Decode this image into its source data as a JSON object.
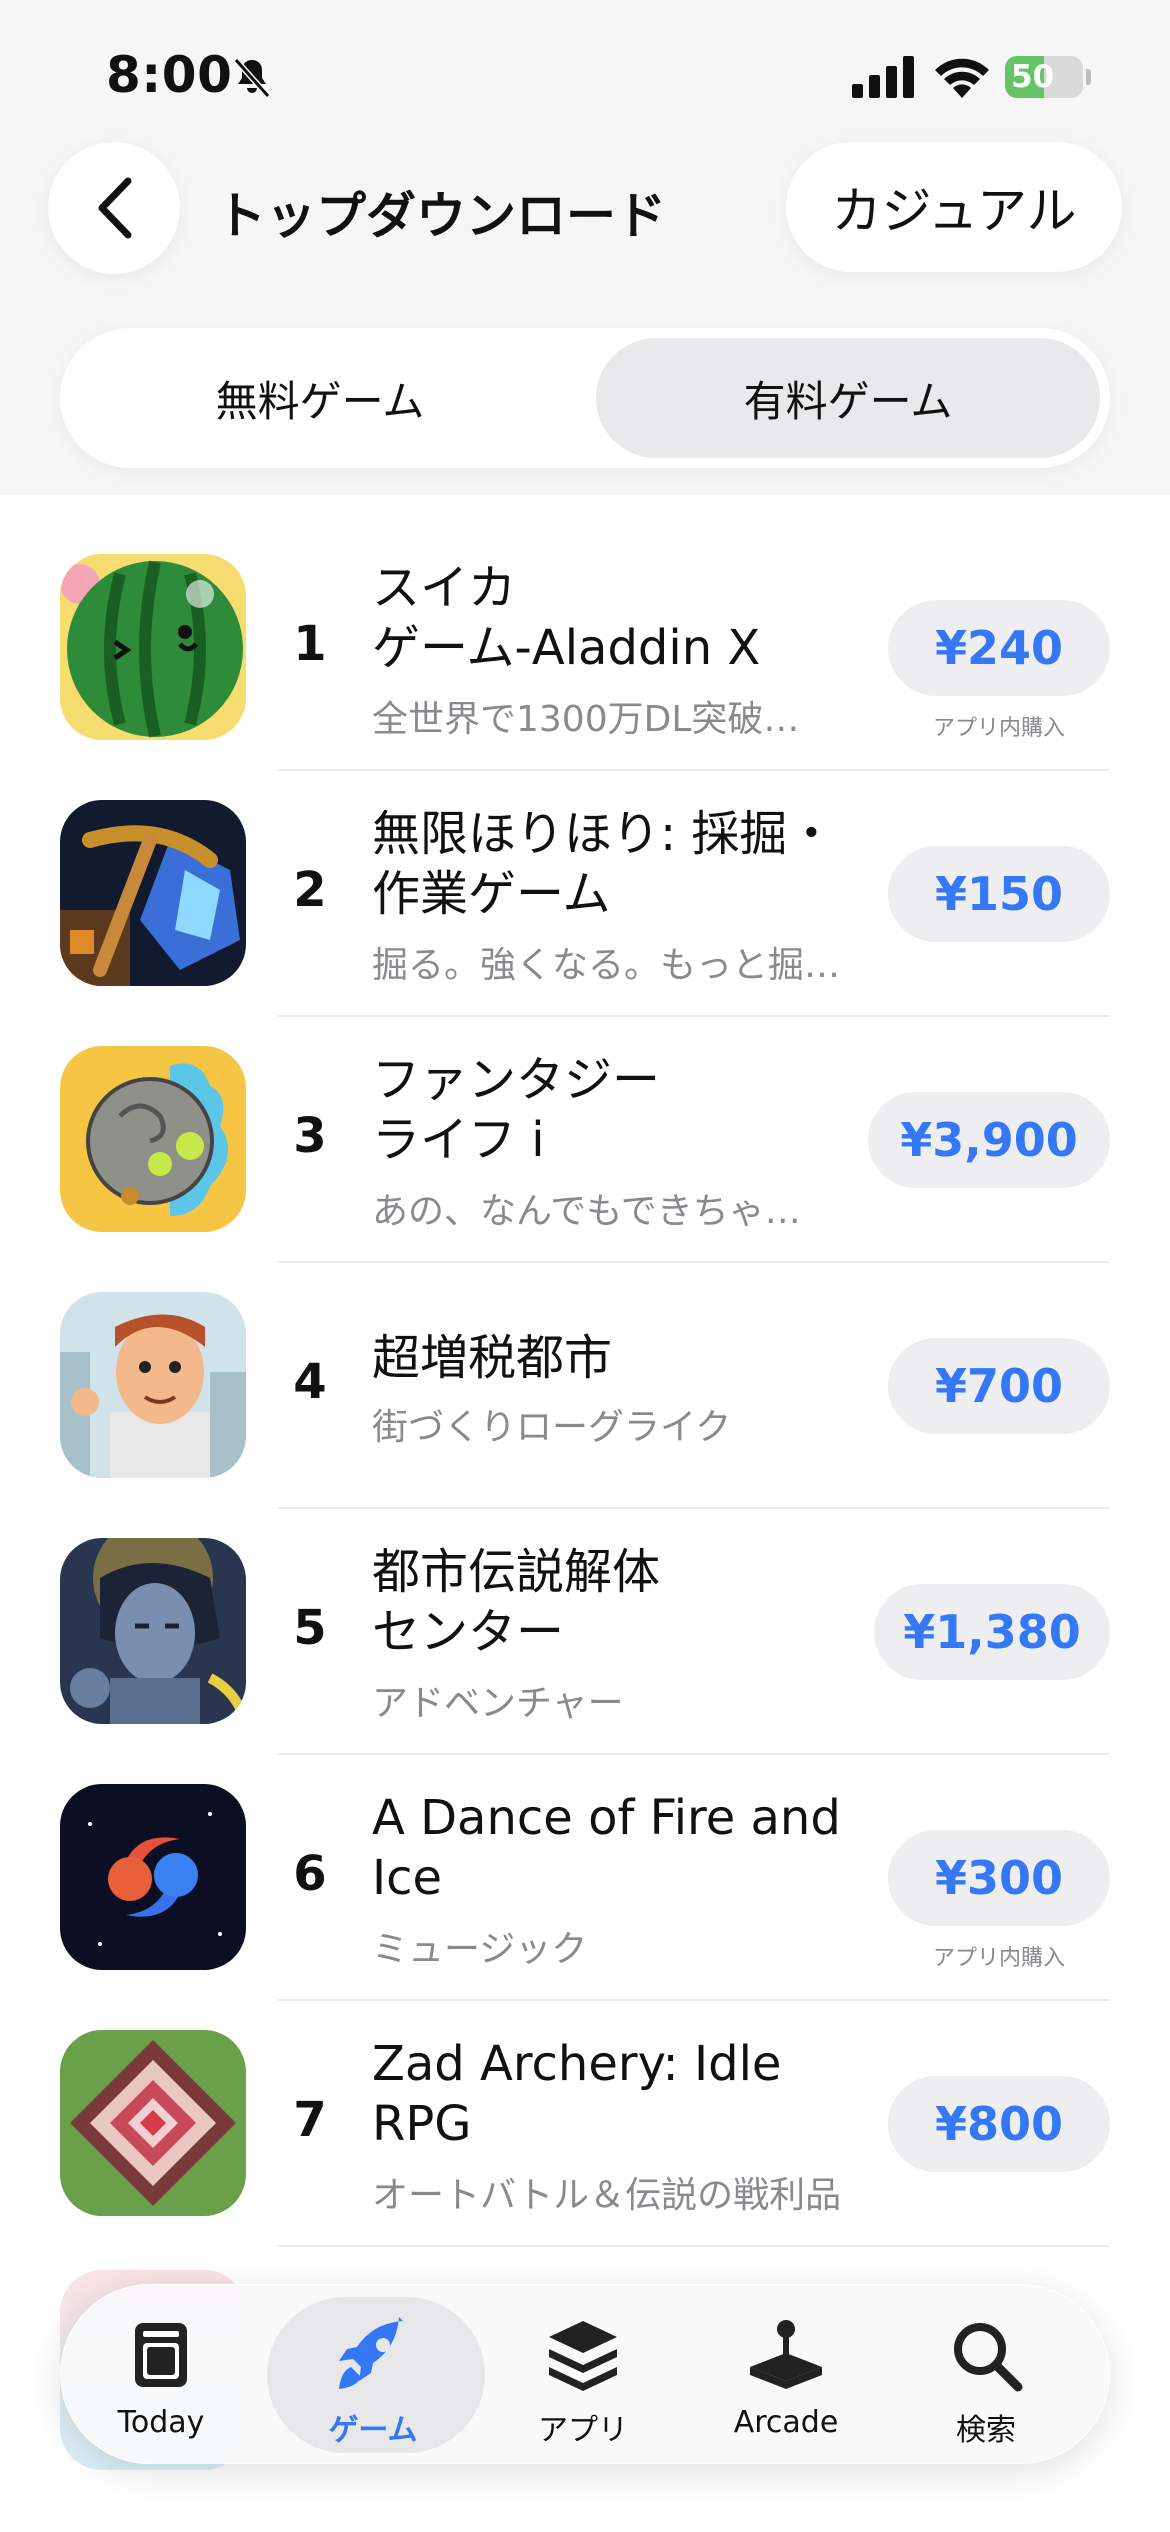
{
  "status_bar": {
    "time": "8:00",
    "battery": "50",
    "battery_level": 0.5
  },
  "header": {
    "title": "トップダウンロード",
    "genre": "カジュアル"
  },
  "segments": {
    "free": "無料ゲーム",
    "paid": "有料ゲーム",
    "selected": "paid"
  },
  "apps": [
    {
      "rank": "1",
      "name": "スイカ\nゲーム-Aladdin X",
      "subtitle": "全世界で1300万DL突破…",
      "price": "¥240",
      "iap": "アプリ内購入"
    },
    {
      "rank": "2",
      "name": "無限ほりほり: 採掘・\n作業ゲーム",
      "subtitle": "掘る。強くなる。もっと掘…",
      "price": "¥150",
      "iap": ""
    },
    {
      "rank": "3",
      "name": "ファンタジー\nライフ i",
      "subtitle": "あの、なんでもできちゃ…",
      "price": "¥3,900",
      "iap": ""
    },
    {
      "rank": "4",
      "name": "超増税都市",
      "subtitle": "街づくりローグライク",
      "price": "¥700",
      "iap": ""
    },
    {
      "rank": "5",
      "name": "都市伝説解体\nセンター",
      "subtitle": "アドベンチャー",
      "price": "¥1,380",
      "iap": ""
    },
    {
      "rank": "6",
      "name": "A Dance of Fire and\nIce",
      "subtitle": "ミュージック",
      "price": "¥300",
      "iap": "アプリ内購入"
    },
    {
      "rank": "7",
      "name": "Zad Archery: Idle\nRPG",
      "subtitle": "オートバトル＆伝説の戦利品",
      "price": "¥800",
      "iap": ""
    }
  ],
  "tabbar": {
    "today": "Today",
    "games": "ゲーム",
    "apps": "アプリ",
    "arcade": "Arcade",
    "search": "検索"
  },
  "colors": {
    "accent": "#3478f6",
    "battery": "#64c466"
  },
  "icons": [
    "bell-slash-icon",
    "signal-icon",
    "wifi-icon",
    "chevron-left-icon",
    "today-icon",
    "rocket-icon",
    "layers-icon",
    "joystick-icon",
    "search-icon"
  ]
}
